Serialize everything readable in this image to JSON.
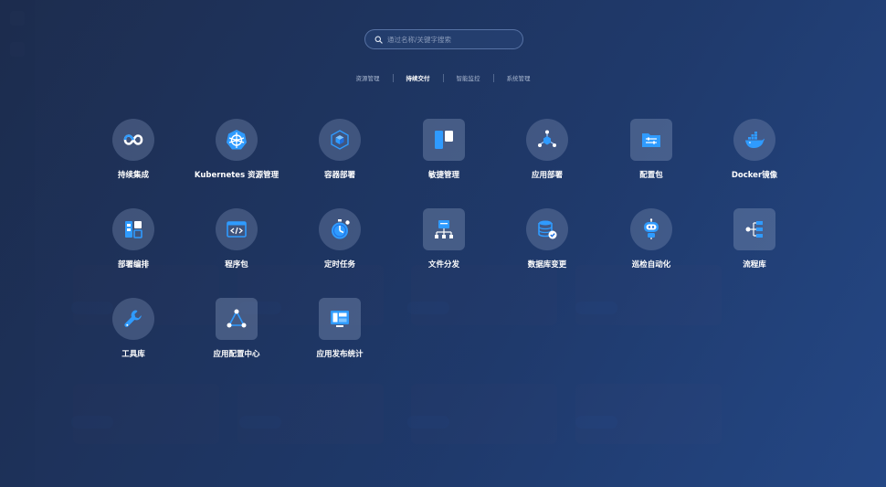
{
  "search": {
    "placeholder": "通过名称/关键字搜索"
  },
  "tabs": [
    {
      "label": "资源管理",
      "active": false
    },
    {
      "label": "持续交付",
      "active": true
    },
    {
      "label": "智能监控",
      "active": false
    },
    {
      "label": "系统管理",
      "active": false
    }
  ],
  "apps": [
    {
      "label": "持续集成",
      "icon": "infinity-loop-icon"
    },
    {
      "label": "Kubernetes 资源管理",
      "icon": "kubernetes-wheel-icon"
    },
    {
      "label": "容器部署",
      "icon": "cube-icon"
    },
    {
      "label": "敏捷管理",
      "icon": "kanban-board-icon"
    },
    {
      "label": "应用部署",
      "icon": "node-network-icon"
    },
    {
      "label": "配置包",
      "icon": "folder-sliders-icon"
    },
    {
      "label": "Docker镜像",
      "icon": "docker-whale-icon"
    },
    {
      "label": "部署编排",
      "icon": "layout-blocks-icon"
    },
    {
      "label": "程序包",
      "icon": "code-window-icon"
    },
    {
      "label": "定时任务",
      "icon": "stopwatch-icon"
    },
    {
      "label": "文件分发",
      "icon": "file-distribution-icon"
    },
    {
      "label": "数据库变更",
      "icon": "database-check-icon"
    },
    {
      "label": "巡检自动化",
      "icon": "robot-icon"
    },
    {
      "label": "流程库",
      "icon": "flow-tree-icon"
    },
    {
      "label": "工具库",
      "icon": "wrench-icon"
    },
    {
      "label": "应用配置中心",
      "icon": "triangle-nodes-icon"
    },
    {
      "label": "应用发布统计",
      "icon": "release-monitor-icon"
    }
  ],
  "colors": {
    "accent": "#2f9bff",
    "accent_dark": "#1f6fe0",
    "overlay": "#1e3a6e"
  }
}
